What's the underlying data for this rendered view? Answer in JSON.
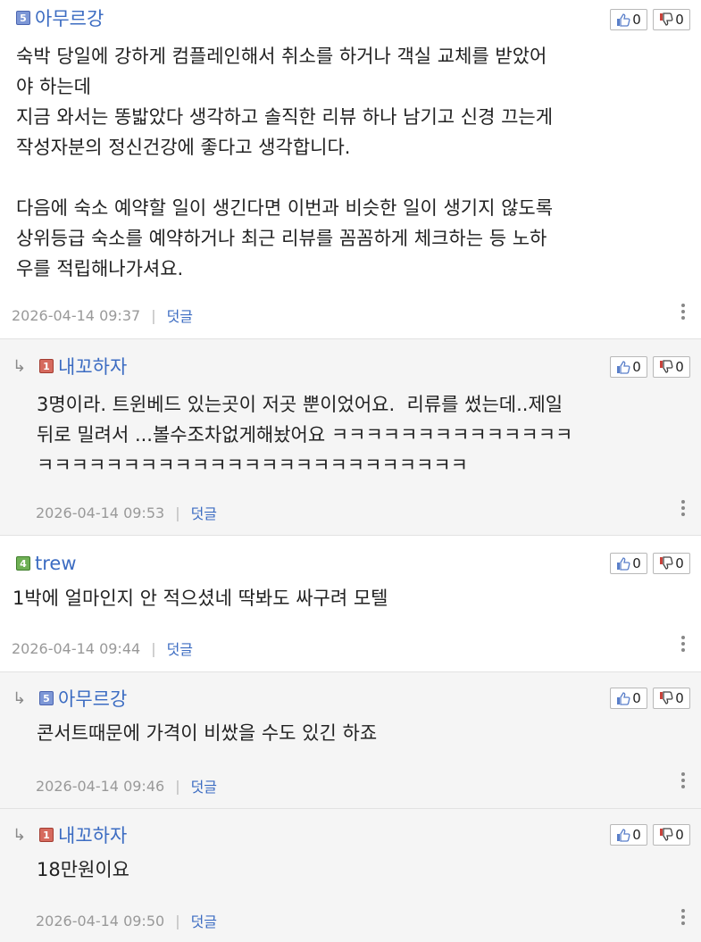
{
  "comments": [
    {
      "level": "5",
      "nick": "아무르강",
      "up": "0",
      "down": "0",
      "text": "숙박 당일에 강하게 컴플레인해서 취소를 하거나 객실 교체를 받았어\n야 하는데\n지금 와서는 똥밟았다 생각하고 솔직한 리뷰 하나 남기고 신경 끄는게\n작성자분의 정신건강에 좋다고 생각합니다.\n\n다음에 숙소 예약할 일이 생긴다면 이번과 비슷한 일이 생기지 않도록\n상위등급 숙소를 예약하거나 최근 리뷰를 꼼꼼하게 체크하는 등 노하\n우를 적립해나가셔요.",
      "date": "2026-04-14 09:37",
      "reply_label": "덧글"
    },
    {
      "level": "1",
      "nick": "내꼬하자",
      "up": "0",
      "down": "0",
      "text": "3명이라. 트윈베드 있는곳이 저곳 뿐이었어요.  리류를 썼는데..제일\n뒤로 밀려서 ...볼수조차없게해놨어요 ㅋㅋㅋㅋㅋㅋㅋㅋㅋㅋㅋㅋㅋㅋ\nㅋㅋㅋㅋㅋㅋㅋㅋㅋㅋㅋㅋㅋㅋㅋㅋㅋㅋㅋㅋㅋㅋㅋㅋㅋ",
      "date": "2026-04-14 09:53",
      "reply_label": "덧글"
    },
    {
      "level": "4",
      "nick": "trew",
      "up": "0",
      "down": "0",
      "text": "1박에 얼마인지 안 적으셨네 딱봐도 싸구려 모텔",
      "date": "2026-04-14 09:44",
      "reply_label": "덧글"
    },
    {
      "level": "5",
      "nick": "아무르강",
      "up": "0",
      "down": "0",
      "text": "콘서트때문에 가격이 비쌌을 수도 있긴 하죠",
      "date": "2026-04-14 09:46",
      "reply_label": "덧글"
    },
    {
      "level": "1",
      "nick": "내꼬하자",
      "up": "0",
      "down": "0",
      "text": "18만원이요",
      "date": "2026-04-14 09:50",
      "reply_label": "덧글"
    }
  ],
  "icons": {
    "reply_arrow": "reply-arrow-icon",
    "thumbs_up": "thumbs-up-icon",
    "thumbs_down": "thumbs-down-icon",
    "more": "more-vertical-icon"
  },
  "colors": {
    "nick": "#3c6cc2",
    "reply_bg": "#f5f5f5",
    "level5": "#7d97d6",
    "level1": "#d66a5e",
    "level4": "#6fb055"
  }
}
